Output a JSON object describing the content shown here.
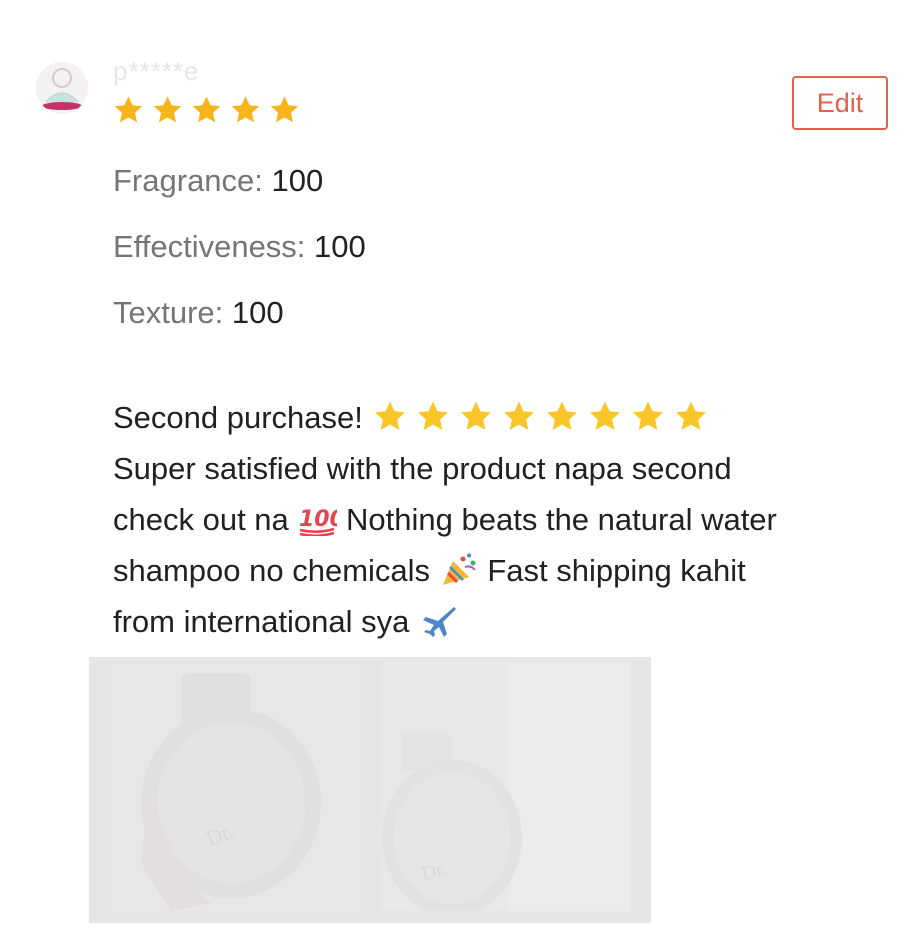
{
  "review": {
    "username": "p*****e",
    "rating": 5,
    "edit_label": "Edit",
    "attributes": [
      {
        "label": "Fragrance:",
        "value": "100"
      },
      {
        "label": "Effectiveness:",
        "value": "100"
      },
      {
        "label": "Texture:",
        "value": "100"
      }
    ],
    "text": {
      "line1": "Second purchase!",
      "line2": "Super satisfied with the product napa second",
      "line3a": "check out na",
      "line3b": "Nothing beats the natural water",
      "line4a": "shampoo no chemicals",
      "line4b": "Fast shipping kahit",
      "line5": "from international sya"
    },
    "inline_emoji": [
      "star x8",
      "hundred-points-icon",
      "party-popper-icon",
      "airplane-icon"
    ],
    "photos_count": 2
  },
  "colors": {
    "star": "#f8b51b",
    "edit": "#e0634d",
    "label": "#757575",
    "value": "#212121",
    "username": "#e6e6e6"
  }
}
